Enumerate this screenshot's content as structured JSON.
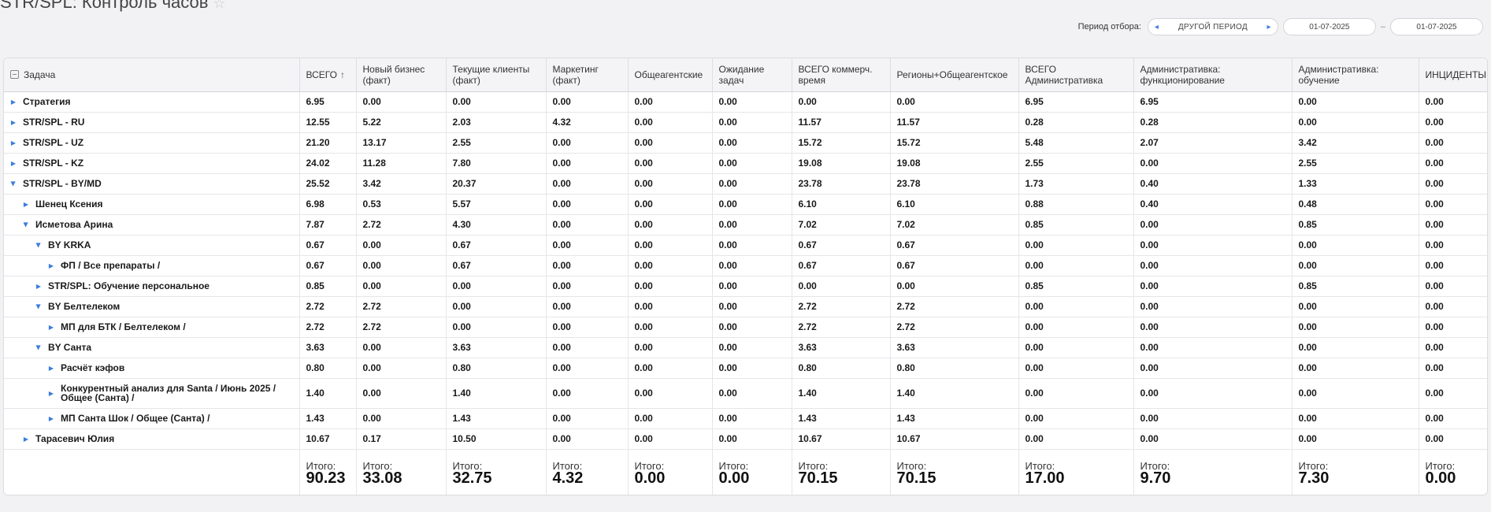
{
  "header": {
    "title": "STR/SPL: Контроль часов",
    "period_label": "Период отбора:",
    "period_value": "ДРУГОЙ ПЕРИОД",
    "date_from": "01-07-2025",
    "date_sep": "–",
    "date_to": "01-07-2025"
  },
  "table": {
    "columns": [
      "Задача",
      "ВСЕГО",
      "Новый бизнес (факт)",
      "Текущие клиенты (факт)",
      "Маркетинг (факт)",
      "Общеагентские",
      "Ожидание задач",
      "ВСЕГО коммерч. время",
      "Регионы+Общеагентское",
      "ВСЕГО Административка",
      "Административка: функционирование",
      "Административка: обучение",
      "ИНЦИДЕНТЫ"
    ],
    "sort_indicator": "↑",
    "rows": [
      {
        "task": "Стратегия",
        "level": 0,
        "expanded": false,
        "values": [
          "6.95",
          "0.00",
          "0.00",
          "0.00",
          "0.00",
          "0.00",
          "0.00",
          "0.00",
          "6.95",
          "6.95",
          "0.00",
          "0.00"
        ]
      },
      {
        "task": "STR/SPL - RU",
        "level": 0,
        "expanded": false,
        "values": [
          "12.55",
          "5.22",
          "2.03",
          "4.32",
          "0.00",
          "0.00",
          "11.57",
          "11.57",
          "0.28",
          "0.28",
          "0.00",
          "0.00"
        ]
      },
      {
        "task": "STR/SPL - UZ",
        "level": 0,
        "expanded": false,
        "values": [
          "21.20",
          "13.17",
          "2.55",
          "0.00",
          "0.00",
          "0.00",
          "15.72",
          "15.72",
          "5.48",
          "2.07",
          "3.42",
          "0.00"
        ]
      },
      {
        "task": "STR/SPL - KZ",
        "level": 0,
        "expanded": false,
        "values": [
          "24.02",
          "11.28",
          "7.80",
          "0.00",
          "0.00",
          "0.00",
          "19.08",
          "19.08",
          "2.55",
          "0.00",
          "2.55",
          "0.00"
        ]
      },
      {
        "task": "STR/SPL - BY/MD",
        "level": 0,
        "expanded": true,
        "values": [
          "25.52",
          "3.42",
          "20.37",
          "0.00",
          "0.00",
          "0.00",
          "23.78",
          "23.78",
          "1.73",
          "0.40",
          "1.33",
          "0.00"
        ]
      },
      {
        "task": "Шенец Ксения",
        "level": 1,
        "expanded": false,
        "values": [
          "6.98",
          "0.53",
          "5.57",
          "0.00",
          "0.00",
          "0.00",
          "6.10",
          "6.10",
          "0.88",
          "0.40",
          "0.48",
          "0.00"
        ]
      },
      {
        "task": "Исметова Арина",
        "level": 1,
        "expanded": true,
        "values": [
          "7.87",
          "2.72",
          "4.30",
          "0.00",
          "0.00",
          "0.00",
          "7.02",
          "7.02",
          "0.85",
          "0.00",
          "0.85",
          "0.00"
        ]
      },
      {
        "task": "BY KRKA",
        "level": 2,
        "expanded": true,
        "values": [
          "0.67",
          "0.00",
          "0.67",
          "0.00",
          "0.00",
          "0.00",
          "0.67",
          "0.67",
          "0.00",
          "0.00",
          "0.00",
          "0.00"
        ]
      },
      {
        "task": "ФП / Все препараты /",
        "level": 3,
        "expanded": false,
        "values": [
          "0.67",
          "0.00",
          "0.67",
          "0.00",
          "0.00",
          "0.00",
          "0.67",
          "0.67",
          "0.00",
          "0.00",
          "0.00",
          "0.00"
        ]
      },
      {
        "task": "STR/SPL: Обучение персональное",
        "level": 2,
        "expanded": false,
        "values": [
          "0.85",
          "0.00",
          "0.00",
          "0.00",
          "0.00",
          "0.00",
          "0.00",
          "0.00",
          "0.85",
          "0.00",
          "0.85",
          "0.00"
        ]
      },
      {
        "task": "BY Белтелеком",
        "level": 2,
        "expanded": true,
        "values": [
          "2.72",
          "2.72",
          "0.00",
          "0.00",
          "0.00",
          "0.00",
          "2.72",
          "2.72",
          "0.00",
          "0.00",
          "0.00",
          "0.00"
        ]
      },
      {
        "task": "МП для БТК / Белтелеком /",
        "level": 3,
        "expanded": false,
        "values": [
          "2.72",
          "2.72",
          "0.00",
          "0.00",
          "0.00",
          "0.00",
          "2.72",
          "2.72",
          "0.00",
          "0.00",
          "0.00",
          "0.00"
        ]
      },
      {
        "task": "BY Санта",
        "level": 2,
        "expanded": true,
        "values": [
          "3.63",
          "0.00",
          "3.63",
          "0.00",
          "0.00",
          "0.00",
          "3.63",
          "3.63",
          "0.00",
          "0.00",
          "0.00",
          "0.00"
        ]
      },
      {
        "task": "Расчёт кэфов",
        "level": 3,
        "expanded": false,
        "values": [
          "0.80",
          "0.00",
          "0.80",
          "0.00",
          "0.00",
          "0.00",
          "0.80",
          "0.80",
          "0.00",
          "0.00",
          "0.00",
          "0.00"
        ]
      },
      {
        "task": "Конкурентный анализ для Santa / Июнь 2025 / Общее (Санта) /",
        "level": 3,
        "expanded": false,
        "tall": true,
        "values": [
          "1.40",
          "0.00",
          "1.40",
          "0.00",
          "0.00",
          "0.00",
          "1.40",
          "1.40",
          "0.00",
          "0.00",
          "0.00",
          "0.00"
        ]
      },
      {
        "task": "МП Санта Шок / Общее (Санта) /",
        "level": 3,
        "expanded": false,
        "values": [
          "1.43",
          "0.00",
          "1.43",
          "0.00",
          "0.00",
          "0.00",
          "1.43",
          "1.43",
          "0.00",
          "0.00",
          "0.00",
          "0.00"
        ]
      },
      {
        "task": "Тарасевич Юлия",
        "level": 1,
        "expanded": false,
        "values": [
          "10.67",
          "0.17",
          "10.50",
          "0.00",
          "0.00",
          "0.00",
          "10.67",
          "10.67",
          "0.00",
          "0.00",
          "0.00",
          "0.00"
        ]
      }
    ],
    "totals_label": "Итого:",
    "totals": [
      "90.23",
      "33.08",
      "32.75",
      "4.32",
      "0.00",
      "0.00",
      "70.15",
      "70.15",
      "17.00",
      "9.70",
      "7.30",
      "0.00"
    ]
  },
  "colors": {
    "accent": "#3b7ddd",
    "header_bg": "#f4f4f6",
    "page_bg": "#f2f2f4"
  },
  "icons": {
    "expand": "caret-right-icon",
    "collapse": "caret-down-icon",
    "columns": "column-toggle-icon"
  }
}
